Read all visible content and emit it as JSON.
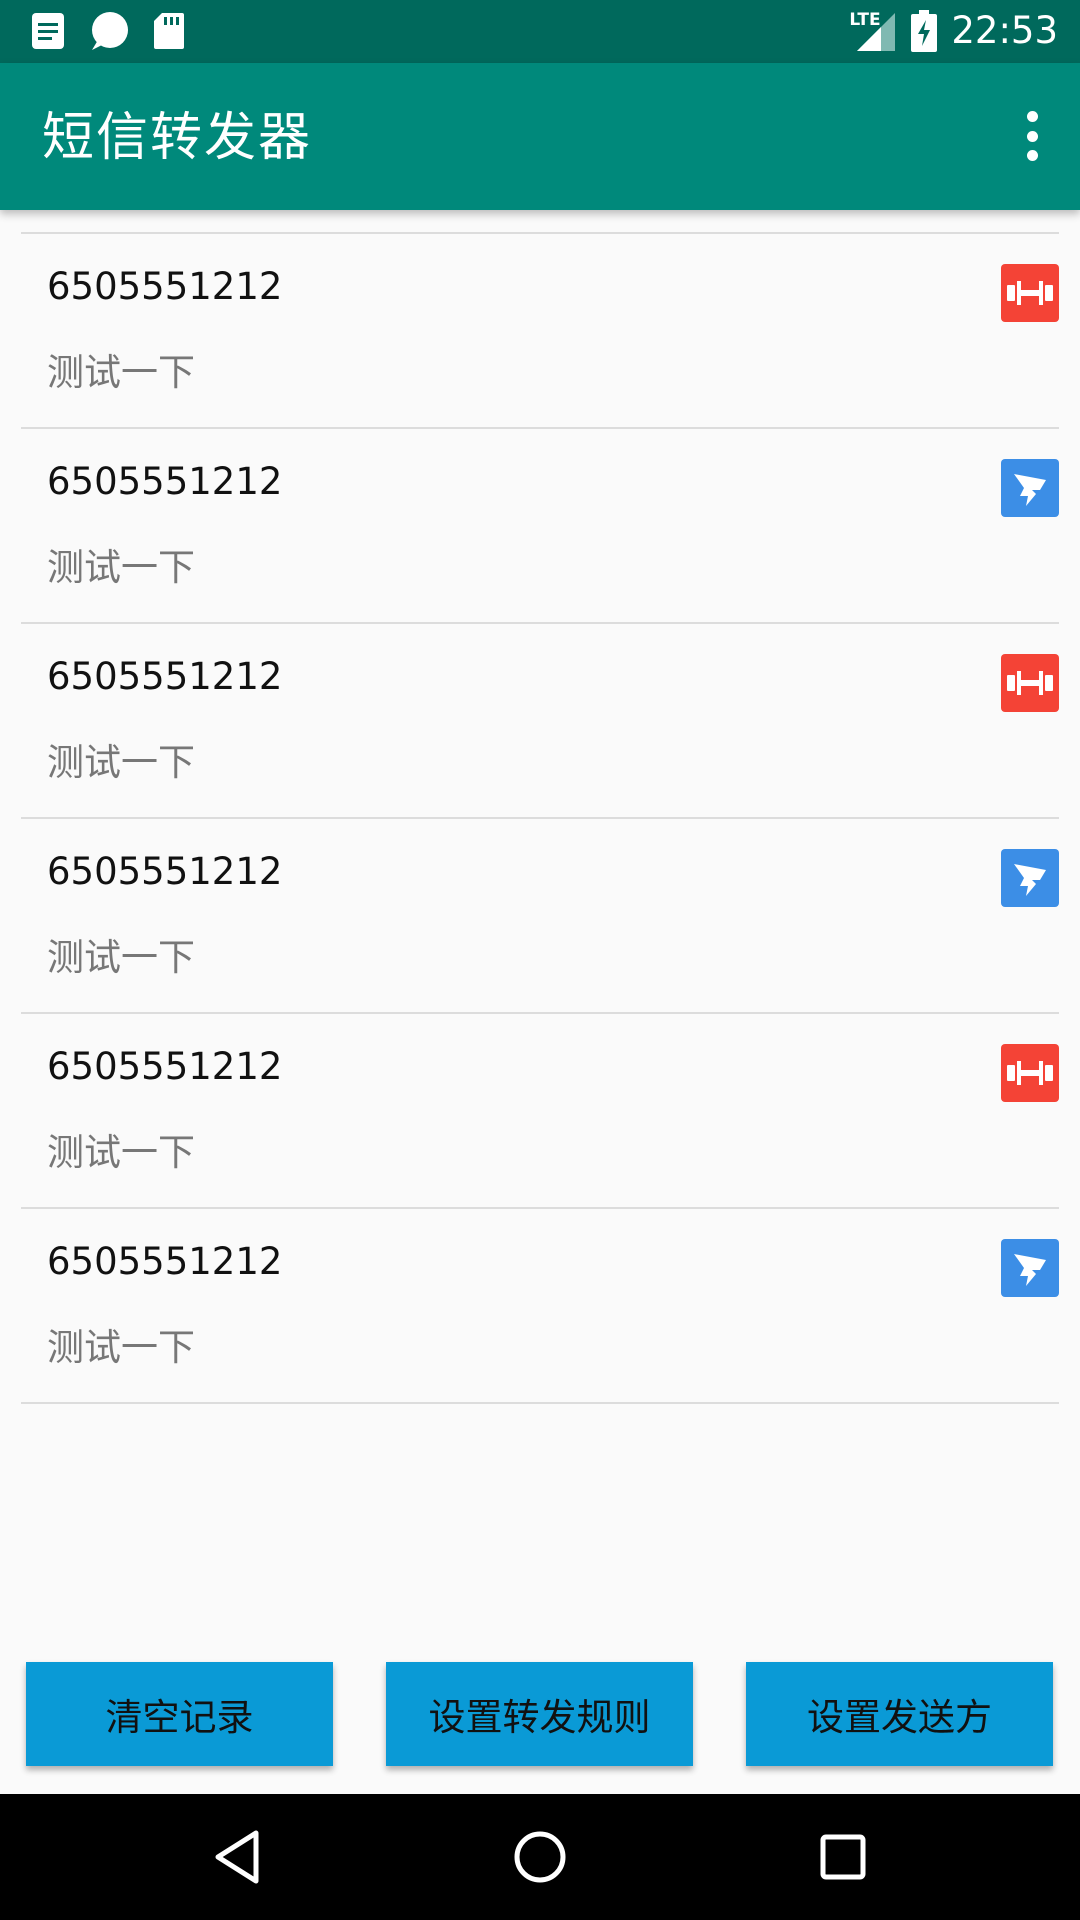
{
  "status_bar": {
    "time": "22:53",
    "network": "LTE",
    "left_icons": [
      "notes-icon",
      "chat-bubble-icon",
      "sd-card-icon"
    ],
    "background": "#00695c"
  },
  "app_bar": {
    "title": "短信转发器",
    "background": "#00897b"
  },
  "messages": [
    {
      "number": "6505551212",
      "text": "测试一下",
      "icon": "dumbbell-icon",
      "icon_color": "#f44336"
    },
    {
      "number": "6505551212",
      "text": "测试一下",
      "icon": "dingtalk-icon",
      "icon_color": "#3c8ee6"
    },
    {
      "number": "6505551212",
      "text": "测试一下",
      "icon": "dumbbell-icon",
      "icon_color": "#f44336"
    },
    {
      "number": "6505551212",
      "text": "测试一下",
      "icon": "dingtalk-icon",
      "icon_color": "#3c8ee6"
    },
    {
      "number": "6505551212",
      "text": "测试一下",
      "icon": "dumbbell-icon",
      "icon_color": "#f44336"
    },
    {
      "number": "6505551212",
      "text": "测试一下",
      "icon": "dingtalk-icon",
      "icon_color": "#3c8ee6"
    }
  ],
  "buttons": {
    "clear": "清空记录",
    "rules": "设置转发规则",
    "sender": "设置发送方",
    "color": "#0a9ad6"
  },
  "nav_bar": {
    "buttons": [
      "back-icon",
      "home-icon",
      "recents-icon"
    ]
  }
}
